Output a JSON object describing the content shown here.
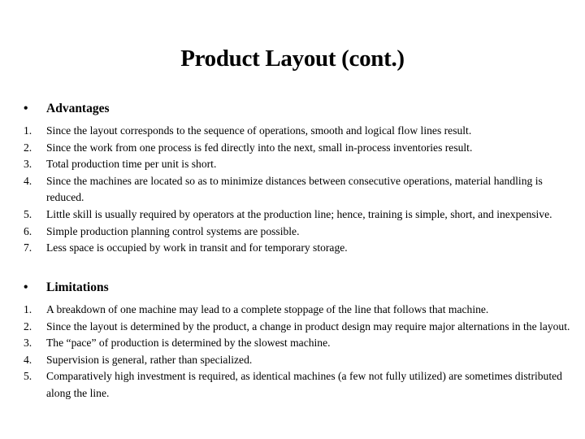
{
  "slide": {
    "title": "Product Layout (cont.)",
    "sections": [
      {
        "bullet": "•",
        "heading": "Advantages",
        "items": [
          {
            "num": "1.",
            "text": "Since the layout corresponds to the sequence of operations, smooth and logical flow lines result."
          },
          {
            "num": "2.",
            "text": "Since the work from one process is fed directly into the next, small in-process inventories result."
          },
          {
            "num": "3.",
            "text": "Total production time per unit is short."
          },
          {
            "num": "4.",
            "text": "Since the machines are located so as to minimize distances between consecutive operations, material handling is reduced."
          },
          {
            "num": "5.",
            "text": "Little skill is usually required by operators at the production line; hence, training is simple, short, and inexpensive."
          },
          {
            "num": "6.",
            "text": "Simple production planning control systems are possible."
          },
          {
            "num": "7.",
            "text": "Less space is occupied by work in transit and for temporary storage."
          }
        ]
      },
      {
        "bullet": "•",
        "heading": "Limitations",
        "items": [
          {
            "num": "1.",
            "text": "A breakdown of one machine may lead to a complete stoppage of the line that follows that machine."
          },
          {
            "num": "2.",
            "text": "Since the layout is determined by the product, a change in product design may require major alternations in the layout."
          },
          {
            "num": "3.",
            "text": "The “pace” of production is determined by the slowest machine."
          },
          {
            "num": "4.",
            "text": "Supervision is general, rather than specialized."
          },
          {
            "num": "5.",
            "text": "Comparatively high investment is required, as identical machines (a few not fully utilized) are sometimes distributed along the line."
          }
        ]
      }
    ]
  }
}
